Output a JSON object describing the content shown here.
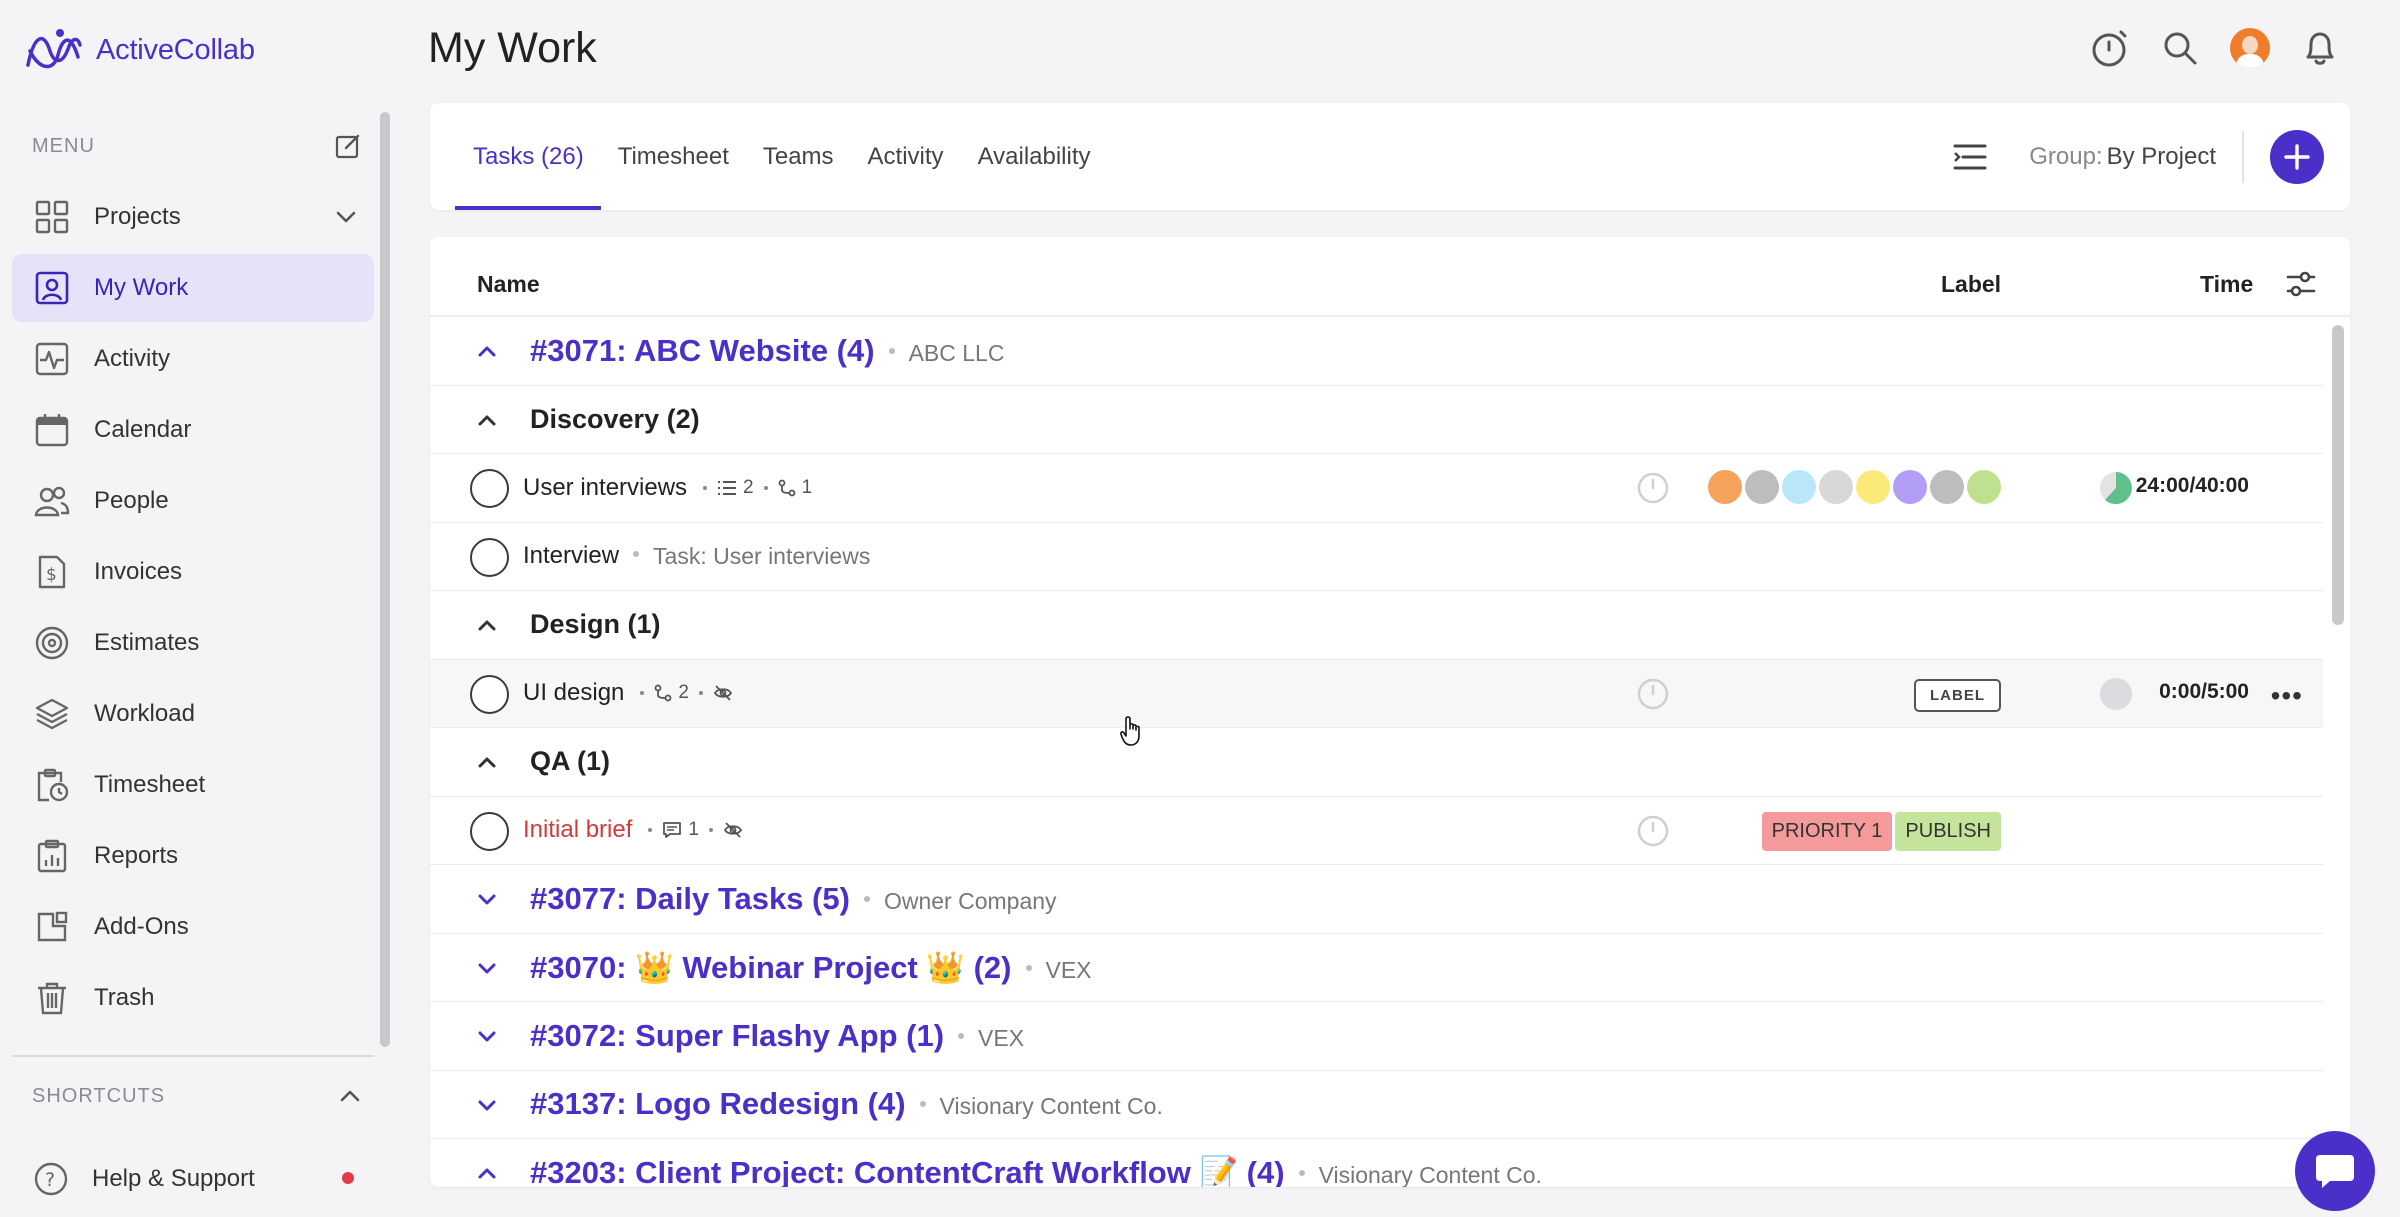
{
  "app": {
    "name": "ActiveCollab"
  },
  "sidebar": {
    "menu_label": "MENU",
    "items": [
      {
        "label": "Projects",
        "icon": "grid-icon"
      },
      {
        "label": "My Work",
        "icon": "user-square-icon",
        "active": true
      },
      {
        "label": "Activity",
        "icon": "activity-icon"
      },
      {
        "label": "Calendar",
        "icon": "calendar-icon"
      },
      {
        "label": "People",
        "icon": "people-icon"
      },
      {
        "label": "Invoices",
        "icon": "invoice-icon"
      },
      {
        "label": "Estimates",
        "icon": "target-icon"
      },
      {
        "label": "Workload",
        "icon": "layers-icon"
      },
      {
        "label": "Timesheet",
        "icon": "timesheet-icon"
      },
      {
        "label": "Reports",
        "icon": "report-icon"
      },
      {
        "label": "Add-Ons",
        "icon": "addons-icon"
      },
      {
        "label": "Trash",
        "icon": "trash-icon"
      }
    ],
    "shortcuts_label": "SHORTCUTS",
    "help_label": "Help & Support"
  },
  "header": {
    "title": "My Work"
  },
  "tabs": {
    "items": [
      "Tasks (26)",
      "Timesheet",
      "Teams",
      "Activity",
      "Availability"
    ],
    "group_label": "Group:",
    "group_value": "By Project"
  },
  "table": {
    "columns": {
      "name": "Name",
      "label": "Label",
      "time": "Time"
    },
    "project_3071": {
      "title": "#3071: ABC Website (4)",
      "client": "ABC LLC"
    },
    "group_discovery": "Discovery (2)",
    "task_user_interviews": {
      "name": "User interviews",
      "subtasks": "2",
      "dependencies": "1",
      "time": "24:00/40:00"
    },
    "task_interview": {
      "name": "Interview",
      "parent": "Task: User interviews"
    },
    "group_design": "Design (1)",
    "task_ui_design": {
      "name": "UI design",
      "dependencies": "2",
      "label": "LABEL",
      "time": "0:00/5:00"
    },
    "group_qa": "QA (1)",
    "task_initial_brief": {
      "name": "Initial brief",
      "comments": "1",
      "tags": [
        "PRIORITY 1",
        "PUBLISH"
      ]
    },
    "project_3077": {
      "title": "#3077: Daily Tasks (5)",
      "client": "Owner Company"
    },
    "project_3070": {
      "title": "#3070: 👑 Webinar Project 👑 (2)",
      "client": "VEX"
    },
    "project_3072": {
      "title": "#3072: Super Flashy App (1)",
      "client": "VEX"
    },
    "project_3137": {
      "title": "#3137: Logo Redesign (4)",
      "client": "Visionary Content Co."
    },
    "project_3203": {
      "title": "#3203: Client Project: ContentCraft Workflow 📝 (4)",
      "client": "Visionary Content Co."
    }
  },
  "colors": {
    "accent": "#4b2fc9",
    "label_dots": [
      "#f5a35c",
      "#bdbdbd",
      "#b9e6fb",
      "#d8d8d8",
      "#fbe97a",
      "#b39ef7",
      "#bdbdbd",
      "#bfe18f"
    ],
    "tag_priority": "#f59a9a",
    "tag_publish": "#c3e49a"
  }
}
